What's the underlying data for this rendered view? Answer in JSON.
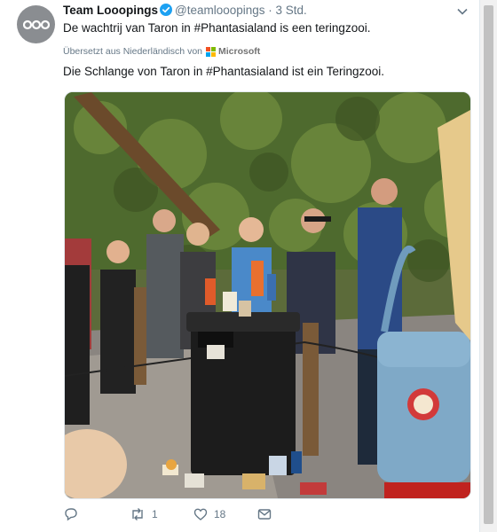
{
  "tweet": {
    "display_name": "Team Looopings",
    "handle": "@teamlooopings",
    "time": "· 3 Std.",
    "text": "De wachtrij van Taron in #Phantasialand is een teringzooi.",
    "translated_note": "Übersetzt aus Niederländisch von",
    "translator": "Microsoft",
    "translation": "Die Schlange von Taron in #Phantasialand ist ein Teringzooi.",
    "colors": {
      "verified": "#1da1f2",
      "secondary_text": "#657786",
      "ms_red": "#f25022",
      "ms_green": "#7fba00",
      "ms_blue": "#00a4ef",
      "ms_yellow": "#ffb900"
    }
  },
  "media": {
    "type": "photo",
    "icons": [
      "trash-bin",
      "backpack",
      "crowd"
    ]
  },
  "actions": {
    "reply_count": "",
    "retweet_count": "1",
    "like_count": "18",
    "icons": [
      "reply-icon",
      "retweet-icon",
      "like-icon",
      "message-icon"
    ]
  }
}
